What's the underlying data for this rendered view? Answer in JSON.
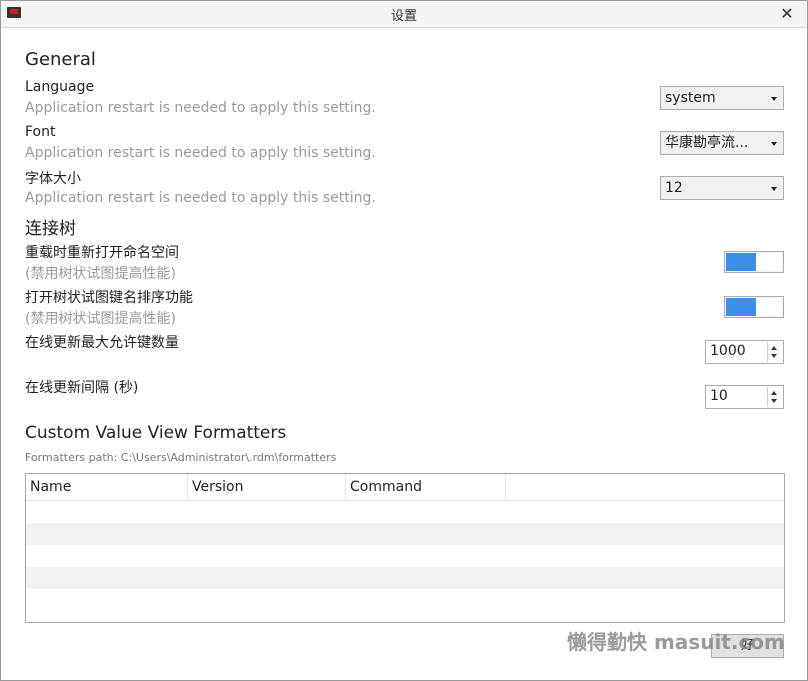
{
  "window": {
    "title": "设置",
    "close_glyph": "✕"
  },
  "general": {
    "title": "General",
    "language": {
      "label": "Language",
      "hint": "Application restart is needed to apply this setting.",
      "value": "system"
    },
    "font": {
      "label": "Font",
      "hint": "Application restart is needed to apply this setting.",
      "value": "华康勘亭流..."
    },
    "font_size": {
      "label": "字体大小",
      "hint": "Application restart is needed to apply this setting.",
      "value": "12"
    }
  },
  "tree": {
    "title": "连接树",
    "reopen_namespaces": {
      "label": "重载时重新打开命名空间",
      "hint": "(禁用树状试图提高性能)",
      "enabled": true
    },
    "sort_keys": {
      "label": "打开树状试图键名排序功能",
      "hint": "(禁用树状试图提高性能)",
      "enabled": true
    },
    "live_update_max_keys": {
      "label": "在线更新最大允许键数量",
      "value": "1000"
    },
    "live_update_interval": {
      "label": "在线更新间隔 (秒)",
      "value": "10"
    }
  },
  "formatters": {
    "title": "Custom Value View Formatters",
    "path": "Formatters path: C:\\Users\\Administrator\\.rdm\\formatters",
    "columns": [
      "Name",
      "Version",
      "Command"
    ]
  },
  "footer": {
    "ok_label": "好",
    "watermark": "懒得勤快 masuit.com"
  },
  "colors": {
    "accent": "#3d8fea"
  }
}
